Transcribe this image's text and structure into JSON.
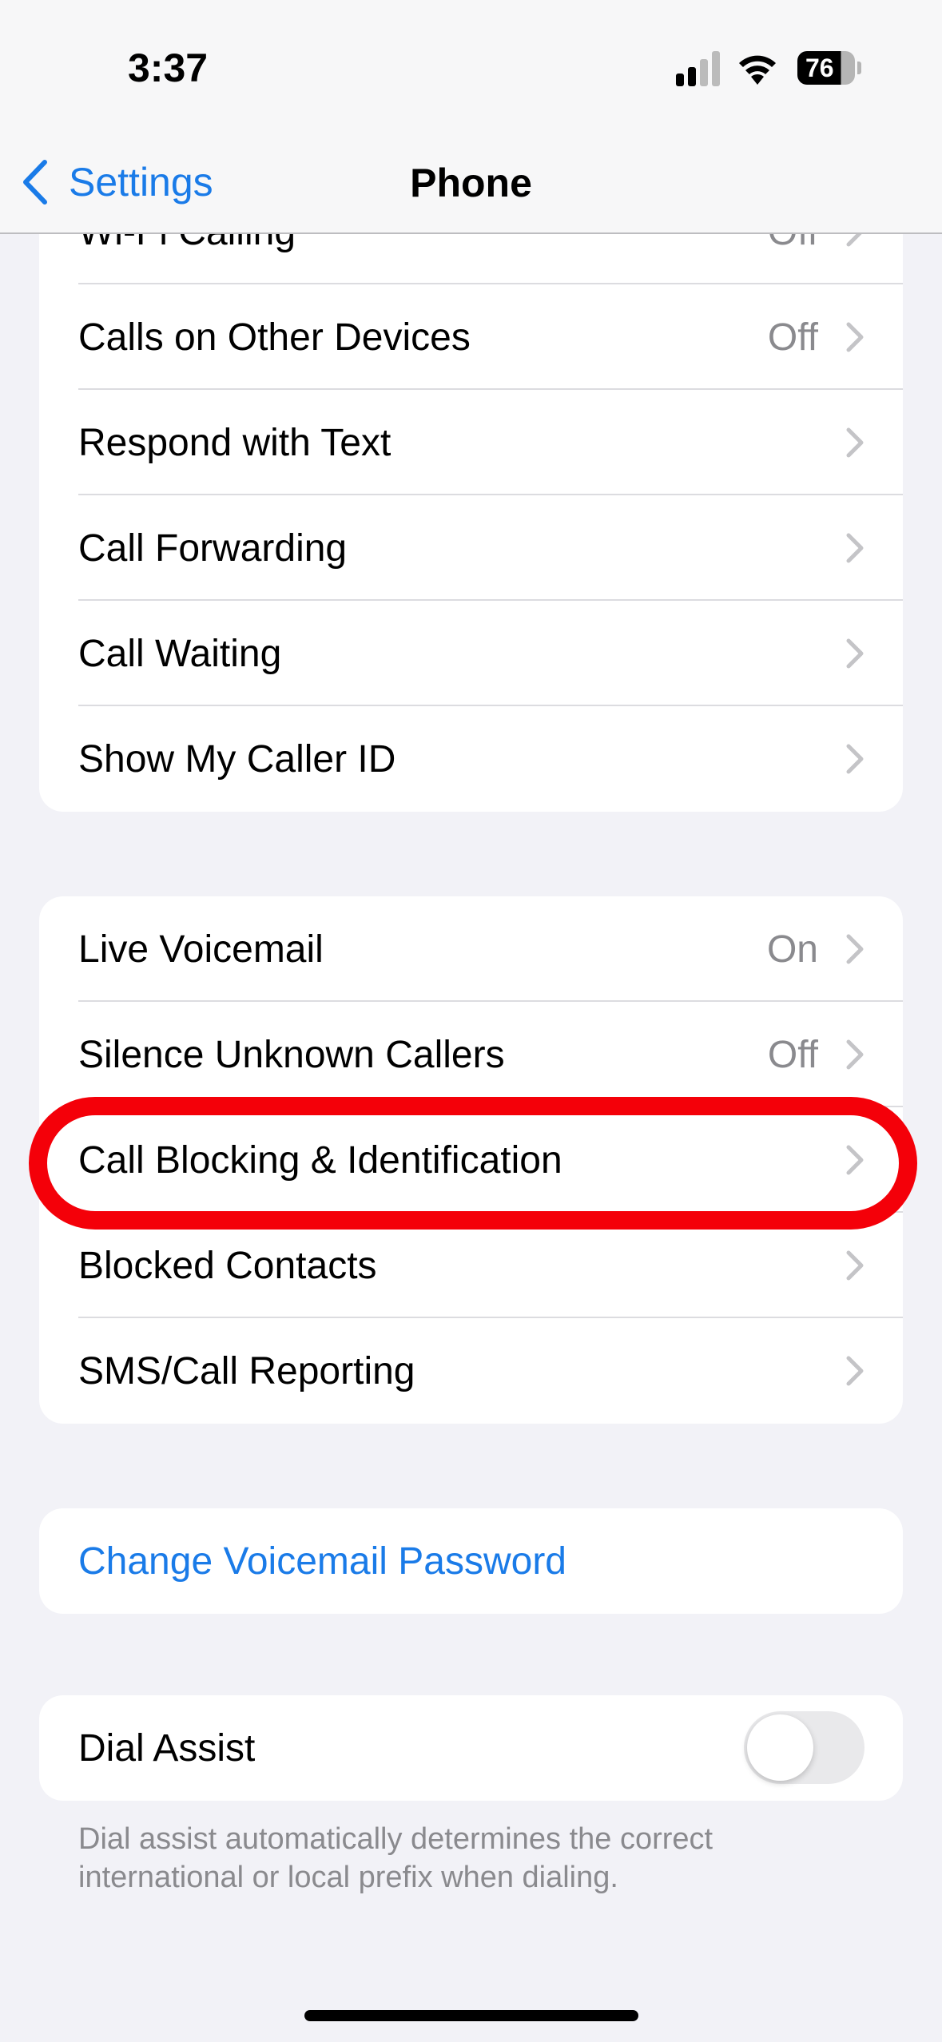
{
  "status_bar": {
    "time": "3:37",
    "battery": "76",
    "icons": [
      "cellular-signal-icon",
      "wifi-icon",
      "battery-icon"
    ]
  },
  "nav": {
    "back_label": "Settings",
    "title": "Phone"
  },
  "group1": [
    {
      "label": "Wi-Fi Calling",
      "value": "Off"
    },
    {
      "label": "Calls on Other Devices",
      "value": "Off"
    },
    {
      "label": "Respond with Text",
      "value": ""
    },
    {
      "label": "Call Forwarding",
      "value": ""
    },
    {
      "label": "Call Waiting",
      "value": ""
    },
    {
      "label": "Show My Caller ID",
      "value": ""
    }
  ],
  "group2": [
    {
      "label": "Live Voicemail",
      "value": "On"
    },
    {
      "label": "Silence Unknown Callers",
      "value": "Off"
    },
    {
      "label": "Call Blocking & Identification",
      "value": "",
      "highlighted": true
    },
    {
      "label": "Blocked Contacts",
      "value": ""
    },
    {
      "label": "SMS/Call Reporting",
      "value": ""
    }
  ],
  "voicemail": {
    "label": "Change Voicemail Password"
  },
  "dial_assist": {
    "label": "Dial Assist",
    "enabled": false,
    "footer": "Dial assist automatically determines the correct international or local prefix when dialing."
  },
  "colors": {
    "accent": "#1a7be8",
    "highlight_ring": "#f40009",
    "background": "#f2f2f7"
  }
}
